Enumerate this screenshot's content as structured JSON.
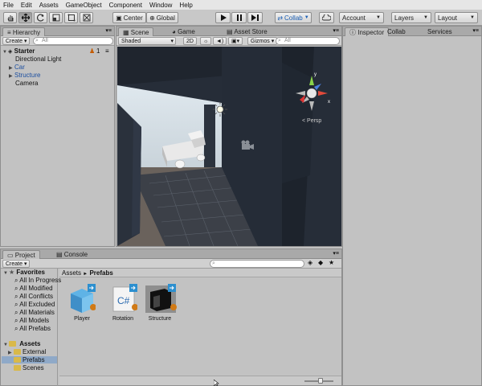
{
  "menu": [
    "File",
    "Edit",
    "Assets",
    "GameObject",
    "Component",
    "Window",
    "Help"
  ],
  "toolbar": {
    "pivot_label": "Center",
    "space_label": "Global",
    "collab_label": "Collab",
    "account_label": "Account",
    "layers_label": "Layers",
    "layout_label": "Layout"
  },
  "hierarchy": {
    "tab": "Hierarchy",
    "create_label": "Create",
    "search_placeholder": "All",
    "scene_name": "Starter",
    "user_count": "1",
    "items": [
      "Directional Light",
      "Car",
      "Structure",
      "Camera"
    ]
  },
  "scene": {
    "tabs": [
      "Scene",
      "Game",
      "Asset Store"
    ],
    "shading": "Shaded",
    "mode_2d": "2D",
    "gizmos": "Gizmos",
    "search_placeholder": "All",
    "persp_label": "< Persp",
    "gizmo_y": "y",
    "gizmo_x": "x"
  },
  "inspector": {
    "tabs": [
      "Inspector",
      "Collab History",
      "Services"
    ]
  },
  "project": {
    "tabs": [
      "Project",
      "Console"
    ],
    "create_label": "Create",
    "favorites_label": "Favorites",
    "favorites": [
      "All In Progress",
      "All Modified",
      "All Conflicts",
      "All Excluded",
      "All Materials",
      "All Models",
      "All Prefabs"
    ],
    "assets_label": "Assets",
    "asset_folders": [
      "External",
      "Prefabs",
      "Scenes"
    ],
    "breadcrumb_root": "Assets",
    "breadcrumb_sep": "►",
    "breadcrumb_current": "Prefabs",
    "items": [
      "Player",
      "Rotation",
      "Structure"
    ],
    "script_glyph": "C#"
  },
  "colors": {
    "selection": "#8fa9c8",
    "link_blue": "#1c4fa0",
    "prefab_blue": "#4da3d9",
    "folder": "#d9b94a"
  }
}
